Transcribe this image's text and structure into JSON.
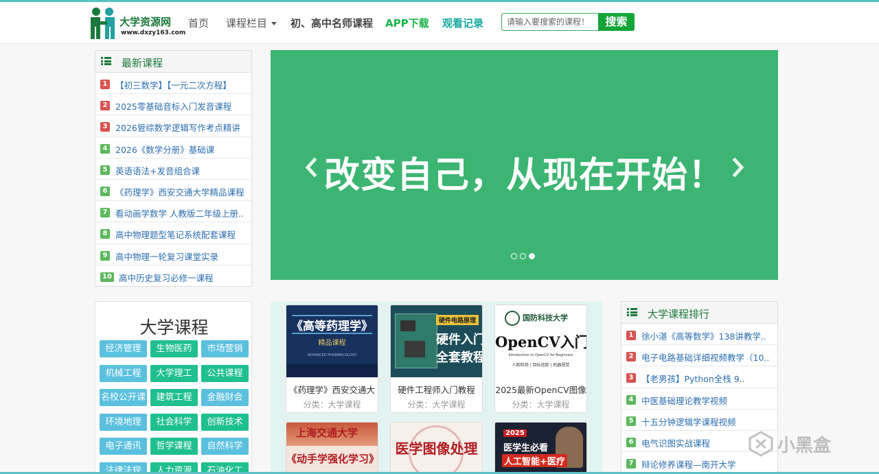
{
  "colors": {
    "accent_top": "#5bc0c4",
    "brand_green": "#1a7a3c",
    "search_green": "#13a538",
    "banner": "#3cb572",
    "link_blue": "#2a6fb0"
  },
  "logo": {
    "title": "大学资源网",
    "url": "www.dxzy163.com"
  },
  "nav": {
    "home": "首页",
    "columns": "课程栏目",
    "teachers": "初、高中名师课程",
    "app": "APP下载",
    "history": "观看记录"
  },
  "search": {
    "placeholder": "请输入要搜索的课程！",
    "button": "搜索"
  },
  "latest": {
    "title": "最新课程",
    "items": [
      {
        "rank": "1",
        "text": "【初三数学】【一元二次方程】"
      },
      {
        "rank": "2",
        "text": "2025零基础音标入门发音课程"
      },
      {
        "rank": "3",
        "text": "2026管综数学逻辑写作考点精讲"
      },
      {
        "rank": "4",
        "text": "2026《数学分册》基础课"
      },
      {
        "rank": "5",
        "text": "英语语法+发音组合课"
      },
      {
        "rank": "6",
        "text": "《药理学》西安交通大学精品课程"
      },
      {
        "rank": "7",
        "text": "看动画学数学 人教版二年级上册.."
      },
      {
        "rank": "8",
        "text": "高中物理题型笔记系统配套课程"
      },
      {
        "rank": "9",
        "text": "高中物理一轮复习课堂实录"
      },
      {
        "rank": "10",
        "text": "高中历史复习必修一课程"
      }
    ]
  },
  "banner": {
    "text": "改变自己，从现在开始！"
  },
  "categories": {
    "title": "大学课程",
    "tags": [
      "经济管理",
      "生物医药",
      "市场营销",
      "机械工程",
      "大学理工",
      "公共课程",
      "名校公开课",
      "建筑工程",
      "金融财会",
      "环境地理",
      "社会科学",
      "创新技术",
      "电子通讯",
      "哲学课程",
      "自然科学",
      "法律法规",
      "人力资源",
      "石油化工"
    ]
  },
  "cards": [
    {
      "title": "《药理学》西安交通大",
      "category": "分类：大学课程",
      "img_title": "《高等药理学》",
      "img_sub": "精品课程",
      "img_en": "ADVANCED PHARMACOLOGY"
    },
    {
      "title": "硬件工程师入门教程",
      "category": "分类：大学课程",
      "img_badge": "硬件电路原理",
      "img_line1": "硬件入门",
      "img_line2": "全套教程"
    },
    {
      "title": "2025最新OpenCV图像",
      "category": "分类：大学课程",
      "img_school": "国防科技大学",
      "img_main": "OpenCV入门",
      "img_en": "Introduction to OpenCV for Beginners",
      "img_sub": "人脸检测 | 目标追踪 | 机器视觉"
    },
    {
      "title": "",
      "category": "",
      "img_school": "上海交通大学",
      "img_main": "《动手学强化学习》"
    },
    {
      "title": "",
      "category": "",
      "img_main": "医学图像处理"
    },
    {
      "title": "",
      "category": "",
      "img_year": "2025",
      "img_line1": "医学生必看",
      "img_line2": "人工智能+医疗"
    }
  ],
  "ranking": {
    "title": "大学课程排行",
    "items": [
      {
        "rank": "1",
        "text": "徐小湛《高等数学》138讲教学.."
      },
      {
        "rank": "2",
        "text": "电子电路基础详细视频教学（10.."
      },
      {
        "rank": "3",
        "text": "【老男孩】Python全栈 9.."
      },
      {
        "rank": "4",
        "text": "中医基础理论教学视频"
      },
      {
        "rank": "5",
        "text": "十五分钟逻辑学课程视频"
      },
      {
        "rank": "6",
        "text": "电气识图实战课程"
      },
      {
        "rank": "7",
        "text": "辩论修养课程—南开大学"
      }
    ]
  },
  "watermark": {
    "text": "小黑盒"
  }
}
